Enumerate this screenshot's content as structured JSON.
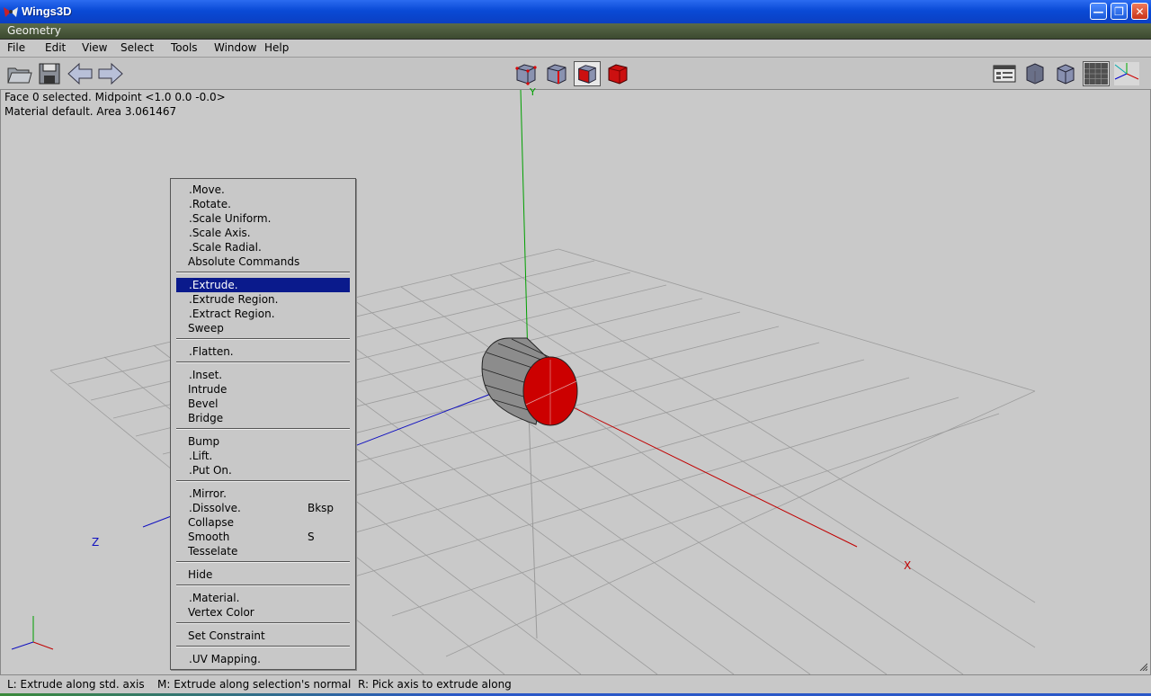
{
  "window": {
    "title": "Wings3D",
    "caption": "Geometry"
  },
  "menubar": {
    "items": [
      "File",
      "Edit",
      "View",
      "Select",
      "Tools",
      "Window",
      "Help"
    ]
  },
  "viewport": {
    "info_line1": "Face 0 selected. Midpoint <1.0  0.0  -0.0>",
    "info_line2": "Material default. Area 3.061467",
    "axis_y": "Y",
    "axis_x": "X",
    "axis_z": "Z"
  },
  "context_menu": {
    "items": [
      {
        "label": ".Move.",
        "hotkey": ""
      },
      {
        "label": ".Rotate.",
        "hotkey": ""
      },
      {
        "label": ".Scale Uniform.",
        "hotkey": ""
      },
      {
        "label": ".Scale Axis.",
        "hotkey": ""
      },
      {
        "label": ".Scale Radial.",
        "hotkey": ""
      },
      {
        "label": "Absolute Commands",
        "hotkey": ""
      },
      {
        "label": ".Extrude.",
        "hotkey": ""
      },
      {
        "label": ".Extrude Region.",
        "hotkey": ""
      },
      {
        "label": ".Extract Region.",
        "hotkey": ""
      },
      {
        "label": "Sweep",
        "hotkey": ""
      },
      {
        "label": ".Flatten.",
        "hotkey": ""
      },
      {
        "label": ".Inset.",
        "hotkey": ""
      },
      {
        "label": "Intrude",
        "hotkey": ""
      },
      {
        "label": "Bevel",
        "hotkey": ""
      },
      {
        "label": "Bridge",
        "hotkey": ""
      },
      {
        "label": "Bump",
        "hotkey": ""
      },
      {
        "label": ".Lift.",
        "hotkey": ""
      },
      {
        "label": ".Put On.",
        "hotkey": ""
      },
      {
        "label": ".Mirror.",
        "hotkey": ""
      },
      {
        "label": ".Dissolve.",
        "hotkey": "Bksp"
      },
      {
        "label": "Collapse",
        "hotkey": ""
      },
      {
        "label": "Smooth",
        "hotkey": "S"
      },
      {
        "label": "Tesselate",
        "hotkey": ""
      },
      {
        "label": "Hide",
        "hotkey": ""
      },
      {
        "label": ".Material.",
        "hotkey": ""
      },
      {
        "label": "Vertex Color",
        "hotkey": ""
      },
      {
        "label": "Set Constraint",
        "hotkey": ""
      },
      {
        "label": ".UV Mapping.",
        "hotkey": ""
      }
    ],
    "highlighted": ".Extrude."
  },
  "statusbar": {
    "left": "L: Extrude along std. axis",
    "middle": "M: Extrude along selection's normal",
    "right": "R: Pick axis to extrude along"
  },
  "colors": {
    "axis_x": "#c00000",
    "axis_y": "#00a000",
    "axis_z": "#1010c0",
    "selected_face": "#cc0000",
    "menu_highlight": "#0a1a8c"
  },
  "icons": {
    "open": "folder-icon",
    "save": "save-disk-icon",
    "undo": "arrow-left-icon",
    "redo": "arrow-right-icon",
    "vertex_mode": "vertex-select-icon",
    "edge_mode": "edge-select-icon",
    "face_mode": "face-select-icon",
    "body_mode": "body-select-icon"
  }
}
